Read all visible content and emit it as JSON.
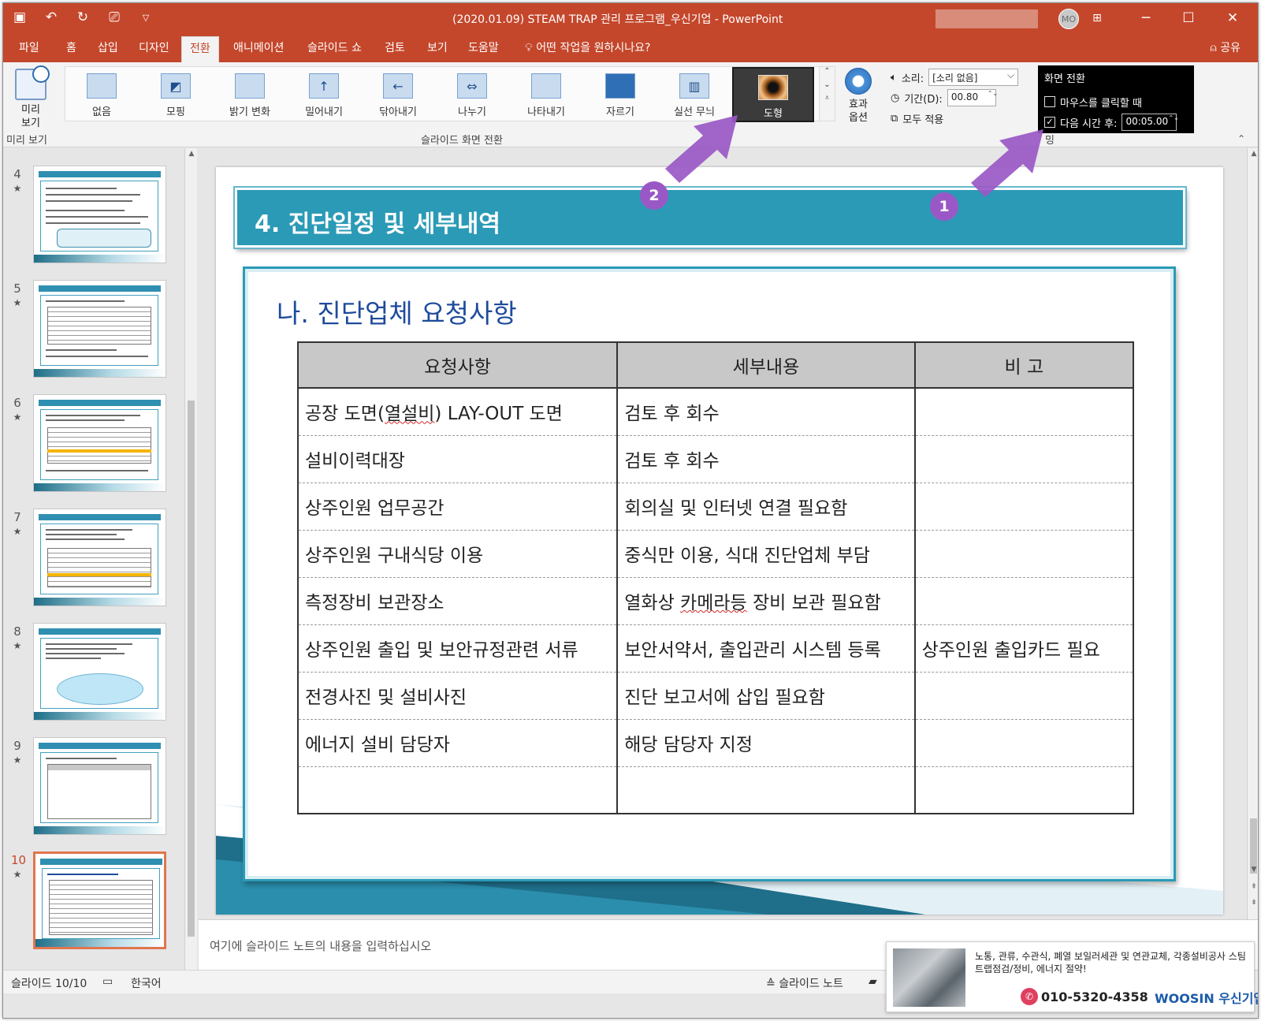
{
  "window": {
    "title": "(2020.01.09) STEAM TRAP 관리 프로그램_우신기업  -  PowerPoint",
    "avatar": "MO"
  },
  "tabs": [
    {
      "label": "파일",
      "active": false
    },
    {
      "label": "홈",
      "active": false
    },
    {
      "label": "삽입",
      "active": false
    },
    {
      "label": "디자인",
      "active": false
    },
    {
      "label": "전환",
      "active": true
    },
    {
      "label": "애니메이션",
      "active": false
    },
    {
      "label": "슬라이드 쇼",
      "active": false
    },
    {
      "label": "검토",
      "active": false
    },
    {
      "label": "보기",
      "active": false
    },
    {
      "label": "도움말",
      "active": false
    }
  ],
  "tell_me": "어떤 작업을 원하시나요?",
  "share": "공유",
  "ribbon": {
    "preview_label": "미리 보기",
    "preview_group": "미리 보기",
    "transitions_group": "슬라이드 화면 전환",
    "transitions": [
      {
        "label": "없음",
        "glyph": ""
      },
      {
        "label": "모핑",
        "glyph": "◩"
      },
      {
        "label": "밝기 변화",
        "glyph": ""
      },
      {
        "label": "밀어내기",
        "glyph": "↑"
      },
      {
        "label": "닦아내기",
        "glyph": "←"
      },
      {
        "label": "나누기",
        "glyph": "⇔"
      },
      {
        "label": "나타내기",
        "glyph": ""
      },
      {
        "label": "자르기",
        "glyph": ""
      },
      {
        "label": "실선 무늬",
        "glyph": "▥"
      },
      {
        "label": "도형",
        "glyph": "",
        "selected": true
      }
    ],
    "effect_options": "효과 옵션",
    "sound_label": "소리:",
    "sound_value": "[소리 없음]",
    "duration_label": "기간(D):",
    "duration_value": "00.80",
    "apply_all": "모두 적용",
    "advance_title": "화면 전환",
    "on_click_label": "마우스를 클릭할 때",
    "on_click_checked": false,
    "after_label": "다음 시간 후:",
    "after_checked": true,
    "after_value": "00:05.00",
    "timing_group_fragment": "밍"
  },
  "thumbnails": [
    {
      "num": "4",
      "current": false
    },
    {
      "num": "5",
      "current": false
    },
    {
      "num": "6",
      "current": false
    },
    {
      "num": "7",
      "current": false
    },
    {
      "num": "8",
      "current": false
    },
    {
      "num": "9",
      "current": false
    },
    {
      "num": "10",
      "current": true
    }
  ],
  "slide": {
    "title": "4. 진단일정 및 세부내역",
    "subtitle": "나. 진단업체 요청사항",
    "table": {
      "headers": [
        "요청사항",
        "세부내용",
        "비 고"
      ],
      "rows": [
        [
          "공장 도면(열설비) LAY-OUT 도면",
          "검토 후 회수",
          ""
        ],
        [
          "설비이력대장",
          "검토 후 회수",
          ""
        ],
        [
          "상주인원 업무공간",
          "회의실 및 인터넷 연결 필요함",
          ""
        ],
        [
          "상주인원 구내식당 이용",
          "중식만 이용, 식대 진단업체 부담",
          ""
        ],
        [
          "측정장비 보관장소",
          "열화상 카메라등 장비 보관 필요함",
          ""
        ],
        [
          "상주인원 출입 및 보안규정관련 서류",
          "보안서약서, 출입관리 시스템 등록",
          "상주인원 출입카드 필요"
        ],
        [
          "전경사진 및 설비사진",
          "진단 보고서에 삽입 필요함",
          ""
        ],
        [
          "에너지 설비 담당자",
          "해당 담당자 지정",
          ""
        ],
        [
          "",
          "",
          ""
        ]
      ]
    }
  },
  "annotations": {
    "badge_1": "1",
    "badge_2": "2",
    "color": "#9a58c6"
  },
  "notes_placeholder": "여기에 슬라이드 노트의 내용을 입력하십시오",
  "status": {
    "slide_counter": "슬라이드 10/10",
    "language": "한국어",
    "notes_button": "슬라이드 노트"
  },
  "ad": {
    "text": "노통, 관류, 수관식, 폐열 보일러세관 및 연관교체, 각종설비공사 스팀트랩점검/정비, 에너지 절약!",
    "phone": "010-5320-4358",
    "brand": "WOOSIN 우신기업"
  },
  "colors": {
    "accent": "#c4472c",
    "slide_teal": "#2b9ab6",
    "subtitle_blue": "#1e4b9b"
  }
}
